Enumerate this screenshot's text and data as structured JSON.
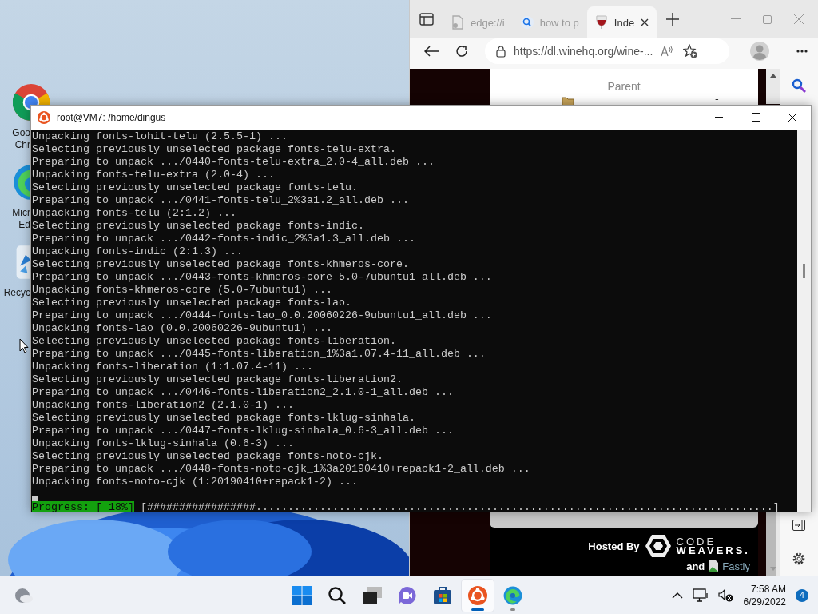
{
  "desktop_icons": [
    {
      "kind": "chrome",
      "lines": [
        "Goo",
        "Chr"
      ]
    },
    {
      "kind": "edge",
      "lines": [
        "Micr",
        "Ed"
      ]
    },
    {
      "kind": "recycle",
      "lines": [
        "Recyc"
      ]
    }
  ],
  "browser": {
    "tabs": [
      {
        "kind": "page",
        "label": "edge://i",
        "selected": false
      },
      {
        "kind": "search",
        "label": "how to p",
        "selected": false
      },
      {
        "kind": "wine",
        "label": "Inde",
        "selected": true
      }
    ],
    "url": "https://dl.winehq.org/wine-...",
    "parent_link": "Parent",
    "size_cell": "-",
    "hosted_by": "Hosted By",
    "sponsor_top": "CODE",
    "sponsor_bottom": "WEAVERS.",
    "and": "and",
    "cdn": "Fastly"
  },
  "terminal": {
    "title": "root@VM7: /home/dingus",
    "lines": [
      "Unpacking fonts-lohit-telu (2.5.5-1) ...",
      "Selecting previously unselected package fonts-telu-extra.",
      "Preparing to unpack .../0440-fonts-telu-extra_2.0-4_all.deb ...",
      "Unpacking fonts-telu-extra (2.0-4) ...",
      "Selecting previously unselected package fonts-telu.",
      "Preparing to unpack .../0441-fonts-telu_2%3a1.2_all.deb ...",
      "Unpacking fonts-telu (2:1.2) ...",
      "Selecting previously unselected package fonts-indic.",
      "Preparing to unpack .../0442-fonts-indic_2%3a1.3_all.deb ...",
      "Unpacking fonts-indic (2:1.3) ...",
      "Selecting previously unselected package fonts-khmeros-core.",
      "Preparing to unpack .../0443-fonts-khmeros-core_5.0-7ubuntu1_all.deb ...",
      "Unpacking fonts-khmeros-core (5.0-7ubuntu1) ...",
      "Selecting previously unselected package fonts-lao.",
      "Preparing to unpack .../0444-fonts-lao_0.0.20060226-9ubuntu1_all.deb ...",
      "Unpacking fonts-lao (0.0.20060226-9ubuntu1) ...",
      "Selecting previously unselected package fonts-liberation.",
      "Preparing to unpack .../0445-fonts-liberation_1%3a1.07.4-11_all.deb ...",
      "Unpacking fonts-liberation (1:1.07.4-11) ...",
      "Selecting previously unselected package fonts-liberation2.",
      "Preparing to unpack .../0446-fonts-liberation2_2.1.0-1_all.deb ...",
      "Unpacking fonts-liberation2 (2.1.0-1) ...",
      "Selecting previously unselected package fonts-lklug-sinhala.",
      "Preparing to unpack .../0447-fonts-lklug-sinhala_0.6-3_all.deb ...",
      "Unpacking fonts-lklug-sinhala (0.6-3) ...",
      "Selecting previously unselected package fonts-noto-cjk.",
      "Preparing to unpack .../0448-fonts-noto-cjk_1%3a20190410+repack1-2_all.deb ...",
      "Unpacking fonts-noto-cjk (1:20190410+repack1-2) ..."
    ],
    "progress_label": "Progress: [ 18%]",
    "progress_bar": "[#################.................................................................................]"
  },
  "taskbar": {
    "apps": [
      {
        "kind": "start",
        "selected": false,
        "running": false
      },
      {
        "kind": "search",
        "selected": false,
        "running": false
      },
      {
        "kind": "taskview",
        "selected": false,
        "running": false
      },
      {
        "kind": "chat",
        "selected": false,
        "running": false
      },
      {
        "kind": "store",
        "selected": false,
        "running": false
      },
      {
        "kind": "ubuntu",
        "selected": true,
        "running": true
      },
      {
        "kind": "edge",
        "selected": false,
        "running": true
      }
    ],
    "time": "7:58 AM",
    "date": "6/29/2022",
    "notification_count": "4"
  }
}
